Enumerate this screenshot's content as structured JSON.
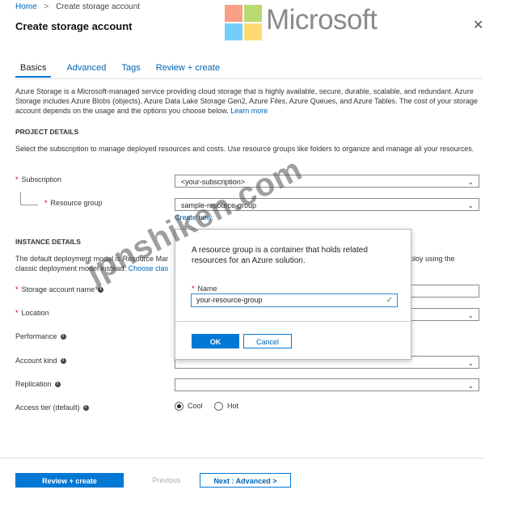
{
  "breadcrumb": {
    "home": "Home",
    "separator": ">",
    "current": "Create storage account"
  },
  "page": {
    "title": "Create storage account",
    "close_icon": "✕"
  },
  "brand": {
    "word": "Microsoft",
    "logo_colors": [
      "#f25022",
      "#7fba00",
      "#00a4ef",
      "#ffb900"
    ]
  },
  "tabs": [
    {
      "label": "Basics",
      "active": true
    },
    {
      "label": "Advanced",
      "active": false
    },
    {
      "label": "Tags",
      "active": false
    },
    {
      "label": "Review + create",
      "active": false
    }
  ],
  "intro": {
    "text": "Azure Storage is a Microsoft-managed service providing cloud storage that is highly available, secure, durable, scalable, and redundant. Azure Storage includes Azure Blobs (objects), Azure Data Lake Storage Gen2, Azure Files, Azure Queues, and Azure Tables. The cost of your storage account depends on the usage and the options you choose below.",
    "link": "Learn more"
  },
  "project": {
    "heading": "PROJECT DETAILS",
    "text": "Select the subscription to manage deployed resources and costs. Use resource groups like folders to organize and manage all your resources.",
    "subscription_label": "Subscription",
    "subscription_value": "<your-subscription>",
    "resource_group_label": "Resource group",
    "resource_group_value": "sample-resource-group",
    "create_new": "Create new"
  },
  "instance": {
    "heading": "INSTANCE DETAILS",
    "text_left": "The default deployment model is Resource Mar",
    "text_right": "ploy using the",
    "text_line2": "classic deployment model instead.",
    "text_line2_link": "Choose clas",
    "storage_name_label": "Storage account name",
    "location_label": "Location",
    "performance_label": "Performance",
    "account_kind_label": "Account kind",
    "replication_label": "Replication",
    "access_tier_label": "Access tier (default)",
    "access_tier_options": [
      "Cool",
      "Hot"
    ],
    "access_tier_selected": "Cool"
  },
  "popup": {
    "text": "A resource group is a container that holds related resources for an Azure solution.",
    "name_label": "Name",
    "name_value": "your-resource-group",
    "ok": "OK",
    "cancel": "Cancel"
  },
  "footer": {
    "review_create": "Review + create",
    "previous": "Previous",
    "next": "Next : Advanced >"
  },
  "watermark": "jpnshiken.com",
  "colors": {
    "accent": "#0078d4",
    "link": "#0063b1",
    "required": "#cc0000"
  }
}
